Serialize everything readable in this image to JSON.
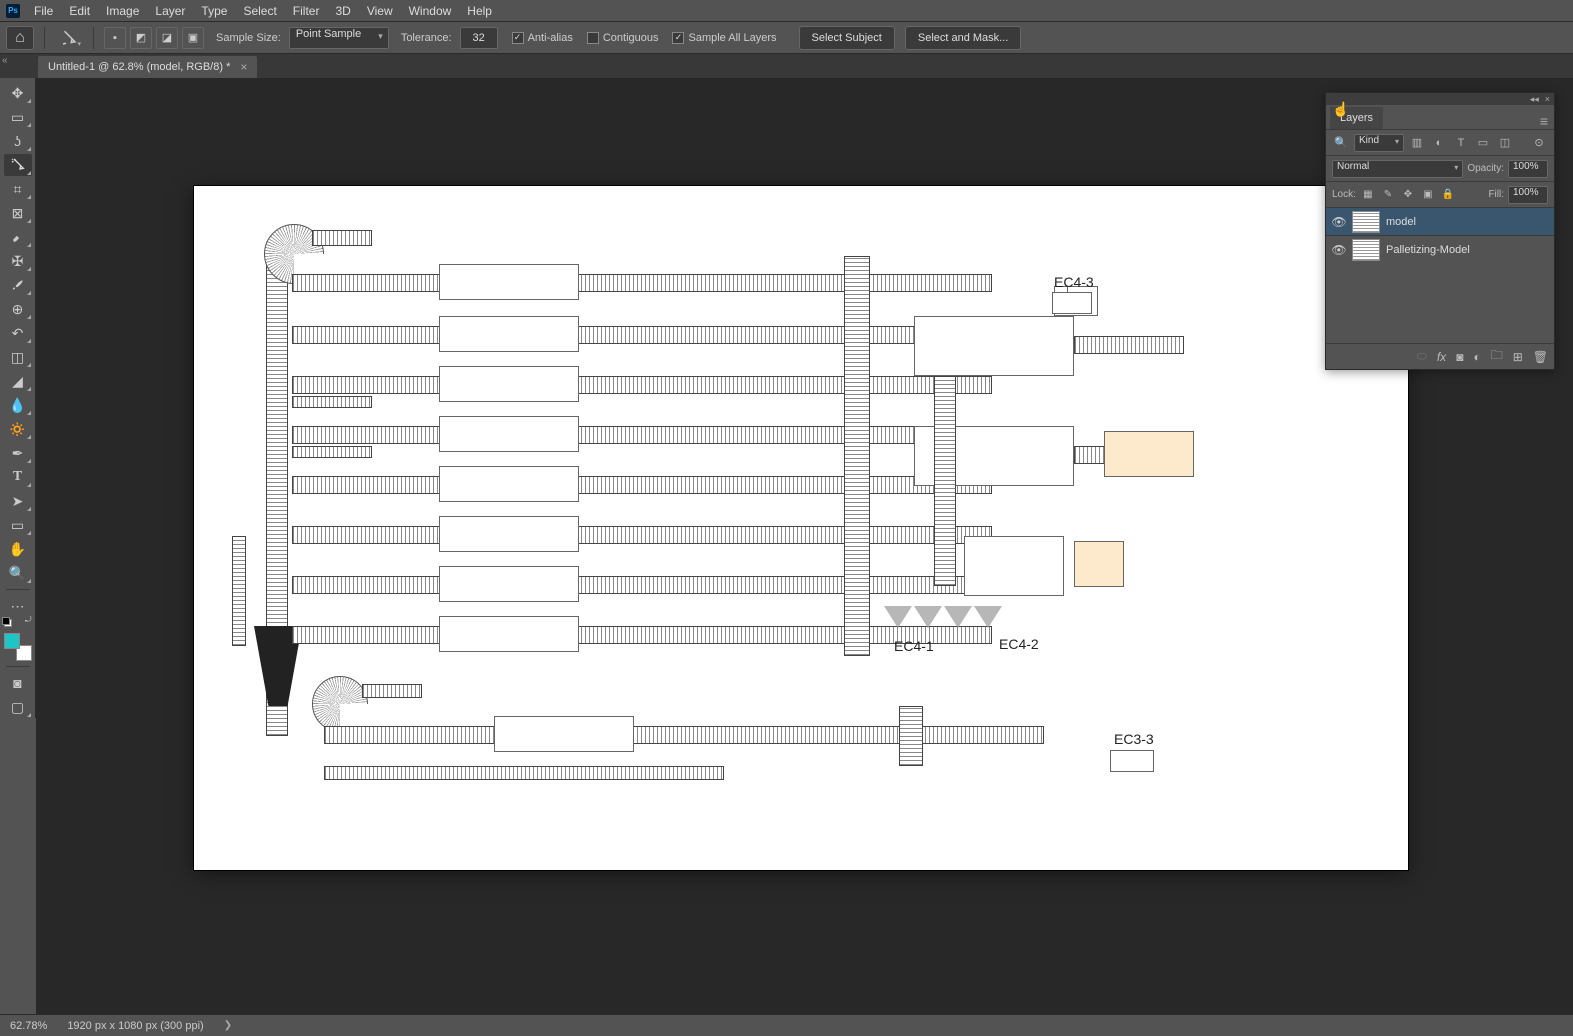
{
  "menu": {
    "items": [
      "File",
      "Edit",
      "Image",
      "Layer",
      "Type",
      "Select",
      "Filter",
      "3D",
      "View",
      "Window",
      "Help"
    ]
  },
  "options": {
    "sample_size_label": "Sample Size:",
    "sample_size_value": "Point Sample",
    "tolerance_label": "Tolerance:",
    "tolerance_value": "32",
    "antialias": "Anti-alias",
    "contiguous": "Contiguous",
    "sample_all": "Sample All Layers",
    "select_subject": "Select Subject",
    "select_and_mask": "Select and Mask..."
  },
  "document": {
    "tab_title": "Untitled-1 @ 62.8% (model, RGB/8) *"
  },
  "canvas": {
    "labels": {
      "ec43": "EC4-3",
      "ec41": "EC4-1",
      "ec42": "EC4-2",
      "ec33": "EC3-3"
    }
  },
  "layers_panel": {
    "title": "Layers",
    "filter_kind": "Kind",
    "blend_mode": "Normal",
    "opacity_label": "Opacity:",
    "opacity_value": "100%",
    "lock_label": "Lock:",
    "fill_label": "Fill:",
    "fill_value": "100%",
    "layers": [
      {
        "name": "model",
        "visible": true,
        "selected": true
      },
      {
        "name": "Palletizing-Model",
        "visible": true,
        "selected": false
      }
    ]
  },
  "status": {
    "zoom": "62.78%",
    "doc_info": "1920 px x 1080 px (300 ppi)"
  }
}
